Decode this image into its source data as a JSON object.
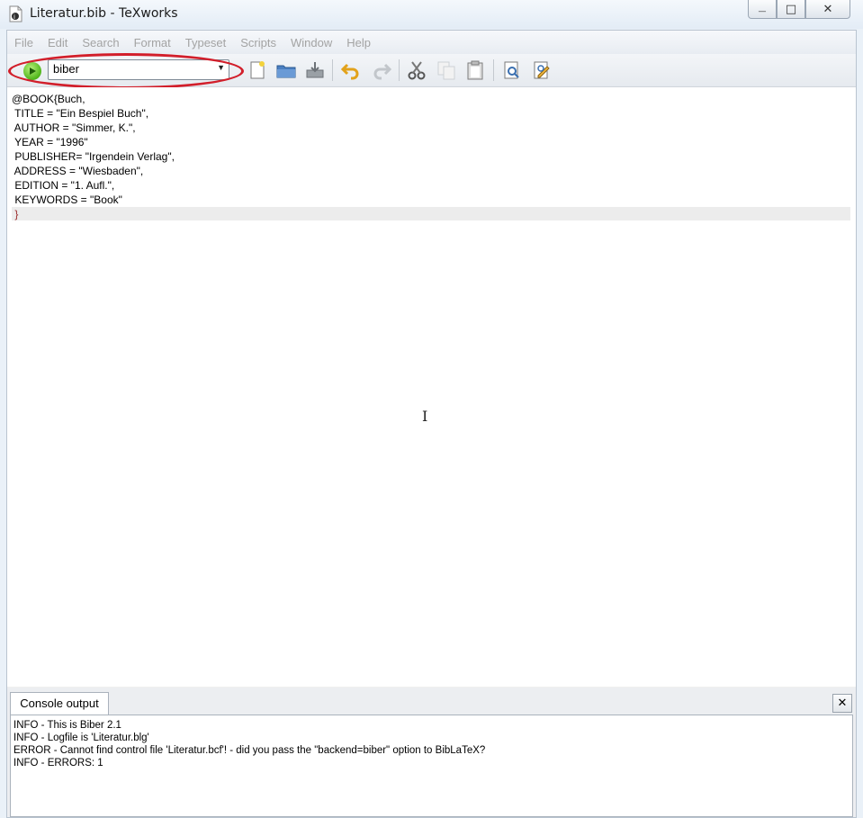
{
  "window": {
    "title": "Literatur.bib - TeXworks",
    "buttons": {
      "minimize": "—",
      "maximize": "□",
      "close": "✕"
    }
  },
  "menu": [
    "File",
    "Edit",
    "Search",
    "Format",
    "Typeset",
    "Scripts",
    "Window",
    "Help"
  ],
  "toolbar": {
    "typeset_engine": "biber",
    "icons": [
      "typeset-play-icon",
      "new-document-icon",
      "open-folder-icon",
      "save-icon",
      "undo-icon",
      "redo-icon",
      "cut-icon",
      "copy-icon",
      "paste-icon",
      "find-icon",
      "replace-icon"
    ]
  },
  "editor": {
    "lines": [
      "@BOOK{Buch,",
      " TITLE = \"Ein Bespiel Buch\",",
      " AUTHOR = \"Simmer, K.\",",
      " YEAR = \"1996\"",
      " PUBLISHER= \"Irgendein Verlag\",",
      " ADDRESS = \"Wiesbaden\",",
      " EDITION = \"1. Aufl.\",",
      " KEYWORDS = \"Book\"",
      " }"
    ]
  },
  "console": {
    "tab_label": "Console output",
    "close_label": "✕",
    "lines": [
      "INFO - This is Biber 2.1",
      "INFO - Logfile is 'Literatur.blg'",
      "ERROR - Cannot find control file 'Literatur.bcf'! - did you pass the \"backend=biber\" option to BibLaTeX?",
      "INFO - ERRORS: 1"
    ]
  },
  "colors": {
    "annotation_ellipse": "#d21e2a",
    "typeset_button": "#4fb51a",
    "menu_disabled": "#a3a3a3"
  }
}
